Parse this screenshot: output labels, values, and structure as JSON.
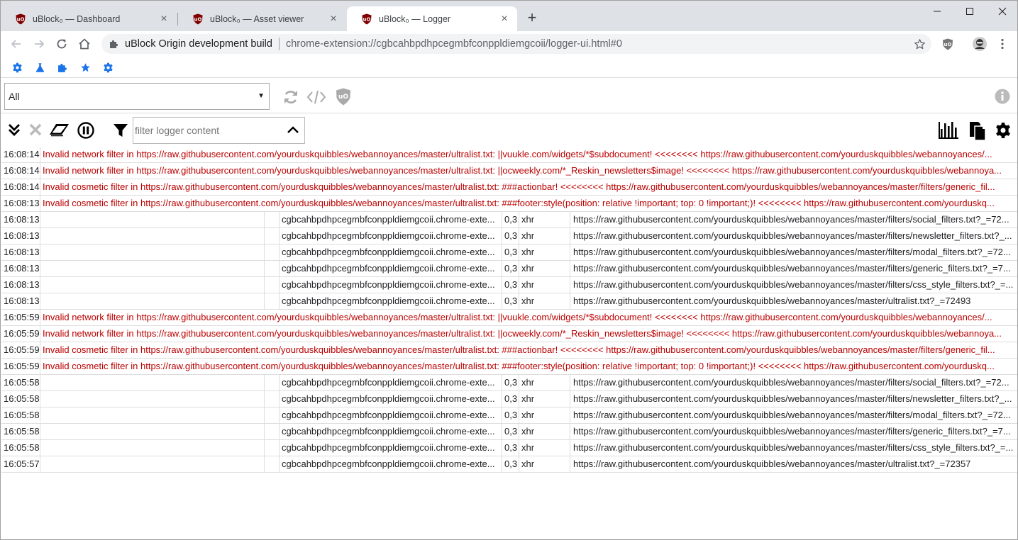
{
  "browser": {
    "tabs": [
      {
        "title": "uBlock₀ — Dashboard",
        "close": "×"
      },
      {
        "title": "uBlock₀ — Asset viewer",
        "close": "×"
      },
      {
        "title": "uBlock₀ — Logger",
        "close": "×",
        "active": true
      }
    ],
    "new_tab": "+",
    "omnibox": {
      "origin": "uBlock Origin development build",
      "url": "chrome-extension://cgbcahbpdhpcegmbfconppldiemgcoii/logger-ui.html#0"
    },
    "bookmarks": [
      "gear-icon",
      "flask-icon",
      "puzzle-icon",
      "star-icon",
      "gear-icon"
    ]
  },
  "logger": {
    "tab_select": {
      "value": "All"
    },
    "filter": {
      "placeholder": "filter logger content"
    },
    "accent": "#bb0000",
    "rows": [
      {
        "time": "16:08:14",
        "kind": "error",
        "msg": "Invalid network filter in https://raw.githubusercontent.com/yourduskquibbles/webannoyances/master/ultralist.txt: ||vuukle.com/widgets/*$subdocument! <<<<<<<< https://raw.githubusercontent.com/yourduskquibbles/webannoyances/..."
      },
      {
        "time": "16:08:14",
        "kind": "error",
        "msg": "Invalid network filter in https://raw.githubusercontent.com/yourduskquibbles/webannoyances/master/ultralist.txt: ||ocweekly.com/*_Reskin_newsletters$image! <<<<<<<< https://raw.githubusercontent.com/yourduskquibbles/webannoya..."
      },
      {
        "time": "16:08:14",
        "kind": "error",
        "msg": "Invalid cosmetic filter in https://raw.githubusercontent.com/yourduskquibbles/webannoyances/master/ultralist.txt: ###actionbar! <<<<<<<< https://raw.githubusercontent.com/yourduskquibbles/webannoyances/master/filters/generic_fil..."
      },
      {
        "time": "16:08:13",
        "kind": "error",
        "msg": "Invalid cosmetic filter in https://raw.githubusercontent.com/yourduskquibbles/webannoyances/master/ultralist.txt: ###footer:style(position: relative !important; top: 0 !important;)! <<<<<<<< https://raw.githubusercontent.com/yourduskq..."
      },
      {
        "time": "16:08:13",
        "kind": "net",
        "ctx": "cgbcahbpdhpcegmbfconppldiemgcoii.chrome-exte...",
        "rank": "0,3",
        "type": "xhr",
        "url": "https://raw.githubusercontent.com/yourduskquibbles/webannoyances/master/filters/social_filters.txt?_=72..."
      },
      {
        "time": "16:08:13",
        "kind": "net",
        "ctx": "cgbcahbpdhpcegmbfconppldiemgcoii.chrome-exte...",
        "rank": "0,3",
        "type": "xhr",
        "url": "https://raw.githubusercontent.com/yourduskquibbles/webannoyances/master/filters/newsletter_filters.txt?_..."
      },
      {
        "time": "16:08:13",
        "kind": "net",
        "ctx": "cgbcahbpdhpcegmbfconppldiemgcoii.chrome-exte...",
        "rank": "0,3",
        "type": "xhr",
        "url": "https://raw.githubusercontent.com/yourduskquibbles/webannoyances/master/filters/modal_filters.txt?_=72..."
      },
      {
        "time": "16:08:13",
        "kind": "net",
        "ctx": "cgbcahbpdhpcegmbfconppldiemgcoii.chrome-exte...",
        "rank": "0,3",
        "type": "xhr",
        "url": "https://raw.githubusercontent.com/yourduskquibbles/webannoyances/master/filters/generic_filters.txt?_=7..."
      },
      {
        "time": "16:08:13",
        "kind": "net",
        "ctx": "cgbcahbpdhpcegmbfconppldiemgcoii.chrome-exte...",
        "rank": "0,3",
        "type": "xhr",
        "url": "https://raw.githubusercontent.com/yourduskquibbles/webannoyances/master/filters/css_style_filters.txt?_=..."
      },
      {
        "time": "16:08:13",
        "kind": "net",
        "ctx": "cgbcahbpdhpcegmbfconppldiemgcoii.chrome-exte...",
        "rank": "0,3",
        "type": "xhr",
        "url": "https://raw.githubusercontent.com/yourduskquibbles/webannoyances/master/ultralist.txt?_=72493"
      },
      {
        "time": "16:05:59",
        "kind": "error",
        "msg": "Invalid network filter in https://raw.githubusercontent.com/yourduskquibbles/webannoyances/master/ultralist.txt: ||vuukle.com/widgets/*$subdocument! <<<<<<<< https://raw.githubusercontent.com/yourduskquibbles/webannoyances/..."
      },
      {
        "time": "16:05:59",
        "kind": "error",
        "msg": "Invalid network filter in https://raw.githubusercontent.com/yourduskquibbles/webannoyances/master/ultralist.txt: ||ocweekly.com/*_Reskin_newsletters$image! <<<<<<<< https://raw.githubusercontent.com/yourduskquibbles/webannoya..."
      },
      {
        "time": "16:05:59",
        "kind": "error",
        "msg": "Invalid cosmetic filter in https://raw.githubusercontent.com/yourduskquibbles/webannoyances/master/ultralist.txt: ###actionbar! <<<<<<<< https://raw.githubusercontent.com/yourduskquibbles/webannoyances/master/filters/generic_fil..."
      },
      {
        "time": "16:05:59",
        "kind": "error",
        "msg": "Invalid cosmetic filter in https://raw.githubusercontent.com/yourduskquibbles/webannoyances/master/ultralist.txt: ###footer:style(position: relative !important; top: 0 !important;)! <<<<<<<< https://raw.githubusercontent.com/yourduskq..."
      },
      {
        "time": "16:05:58",
        "kind": "net",
        "ctx": "cgbcahbpdhpcegmbfconppldiemgcoii.chrome-exte...",
        "rank": "0,3",
        "type": "xhr",
        "url": "https://raw.githubusercontent.com/yourduskquibbles/webannoyances/master/filters/social_filters.txt?_=72..."
      },
      {
        "time": "16:05:58",
        "kind": "net",
        "ctx": "cgbcahbpdhpcegmbfconppldiemgcoii.chrome-exte...",
        "rank": "0,3",
        "type": "xhr",
        "url": "https://raw.githubusercontent.com/yourduskquibbles/webannoyances/master/filters/newsletter_filters.txt?_..."
      },
      {
        "time": "16:05:58",
        "kind": "net",
        "ctx": "cgbcahbpdhpcegmbfconppldiemgcoii.chrome-exte...",
        "rank": "0,3",
        "type": "xhr",
        "url": "https://raw.githubusercontent.com/yourduskquibbles/webannoyances/master/filters/modal_filters.txt?_=72..."
      },
      {
        "time": "16:05:58",
        "kind": "net",
        "ctx": "cgbcahbpdhpcegmbfconppldiemgcoii.chrome-exte...",
        "rank": "0,3",
        "type": "xhr",
        "url": "https://raw.githubusercontent.com/yourduskquibbles/webannoyances/master/filters/generic_filters.txt?_=7..."
      },
      {
        "time": "16:05:58",
        "kind": "net",
        "ctx": "cgbcahbpdhpcegmbfconppldiemgcoii.chrome-exte...",
        "rank": "0,3",
        "type": "xhr",
        "url": "https://raw.githubusercontent.com/yourduskquibbles/webannoyances/master/filters/css_style_filters.txt?_=..."
      },
      {
        "time": "16:05:57",
        "kind": "net",
        "ctx": "cgbcahbpdhpcegmbfconppldiemgcoii.chrome-exte...",
        "rank": "0,3",
        "type": "xhr",
        "url": "https://raw.githubusercontent.com/yourduskquibbles/webannoyances/master/ultralist.txt?_=72357"
      }
    ]
  }
}
